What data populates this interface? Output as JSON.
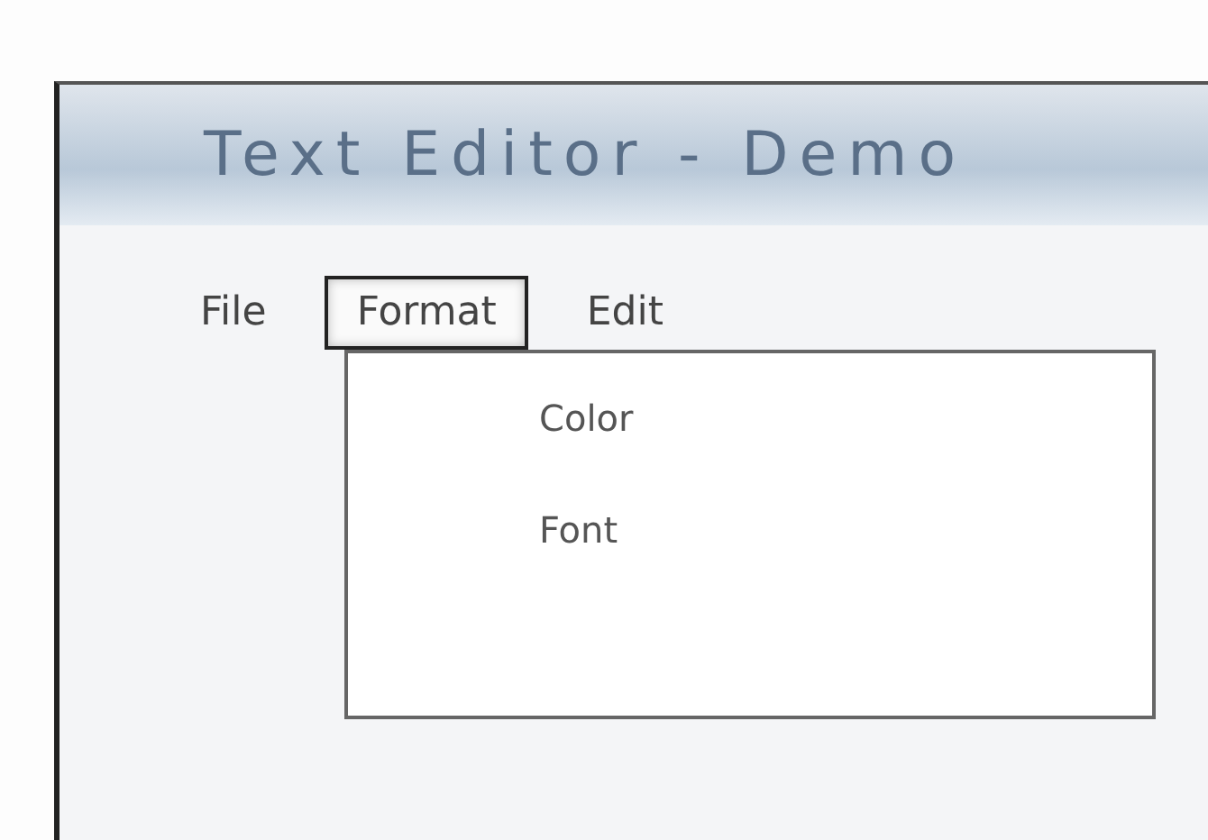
{
  "window": {
    "title": "Text Editor - Demo"
  },
  "menu": [
    {
      "label": "File",
      "selected": false
    },
    {
      "label": "Format",
      "selected": true
    },
    {
      "label": "Edit",
      "selected": false
    }
  ],
  "dropdown": {
    "items": [
      "Color",
      "Font"
    ]
  }
}
